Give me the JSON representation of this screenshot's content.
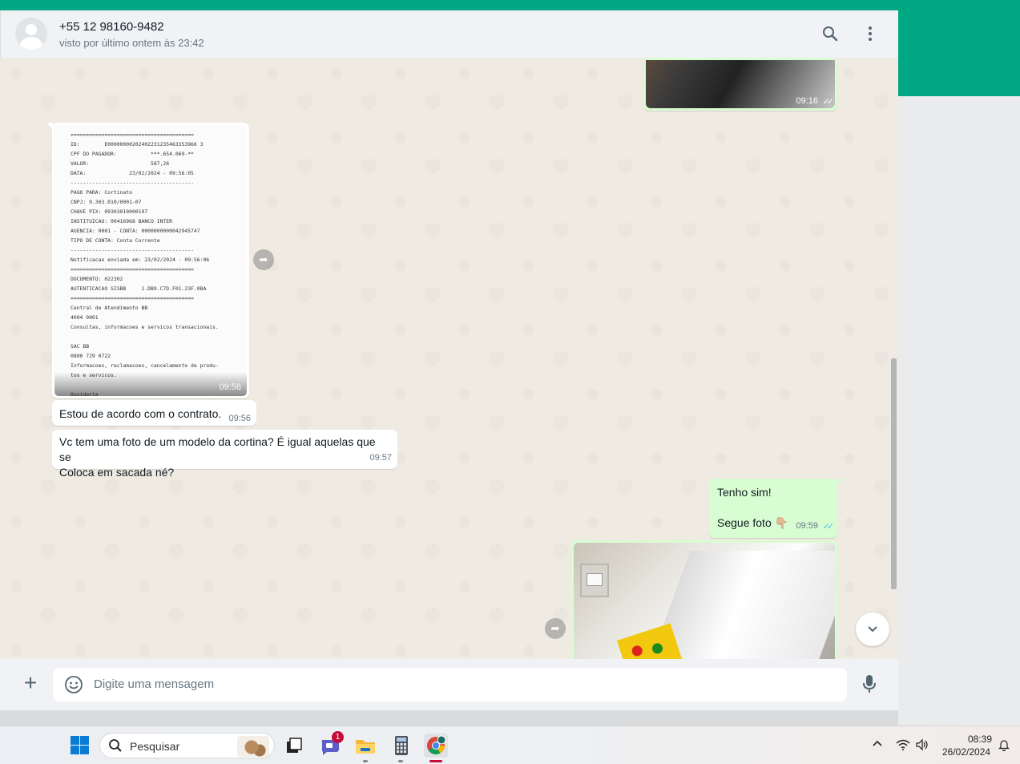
{
  "header": {
    "contact_name": "+55 12 98160-9482",
    "contact_status": "visto por último ontem às 23:42"
  },
  "messages": {
    "photo_top_time": "09:16",
    "receipt_time": "09:56",
    "receipt_lines": [
      "========================================",
      "ID:        E00000000202402231235463353966 3",
      "CPF DO PAGADOR:           ***.654.069-**",
      "VALOR:                    587,26",
      "DATA:              23/02/2024 - 09:56:05",
      "----------------------------------------",
      "PAGO PARA: Cortinato",
      "CNPJ: 9.303.010/0001-07",
      "CHAVE PIX: 09303010000107",
      "INSTITUICAO: 00416968 BANCO INTER",
      "AGENCIA: 0001 - CONTA: 0000000000042945747",
      "TIPO DE CONTA: Conta Corrente",
      "----------------------------------------",
      "Notificacao enviada em: 23/02/2024 - 09:56:06",
      "========================================",
      "DOCUMENTO: 022302",
      "AUTENTICACAO SISBB     1.DB9.C7D.F01.23F.0BA",
      "========================================",
      "Central de Atendimento BB",
      "4004 0001",
      "Consultas, informacoes e servicos transacionais.",
      "",
      "SAC BB",
      "0800 729 0722",
      "Informacoes, reclamacoes, cancelamento de produ-",
      "tos e servicos.",
      "",
      "Ouvidoria"
    ],
    "msg1_text": "Estou de acordo com o contrato.",
    "msg1_time": "09:56",
    "msg2_line1": "Vc tem uma foto de um modelo da cortina? É igual aquelas que se",
    "msg2_line2": "Coloca em sacada né?",
    "msg2_time": "09:57",
    "msg3_line1": "Tenho sim!",
    "msg3_line2": "Segue foto 👇🏼",
    "msg3_time": "09:59"
  },
  "footer": {
    "placeholder": "Digite uma mensagem"
  },
  "taskbar": {
    "search_label": "Pesquisar",
    "chat_badge": "1",
    "time": "08:39",
    "date": "26/02/2024"
  },
  "colors": {
    "brand_green": "#00a884",
    "outgoing_bubble": "#d9fdd3",
    "read_ticks": "#53bdeb"
  }
}
